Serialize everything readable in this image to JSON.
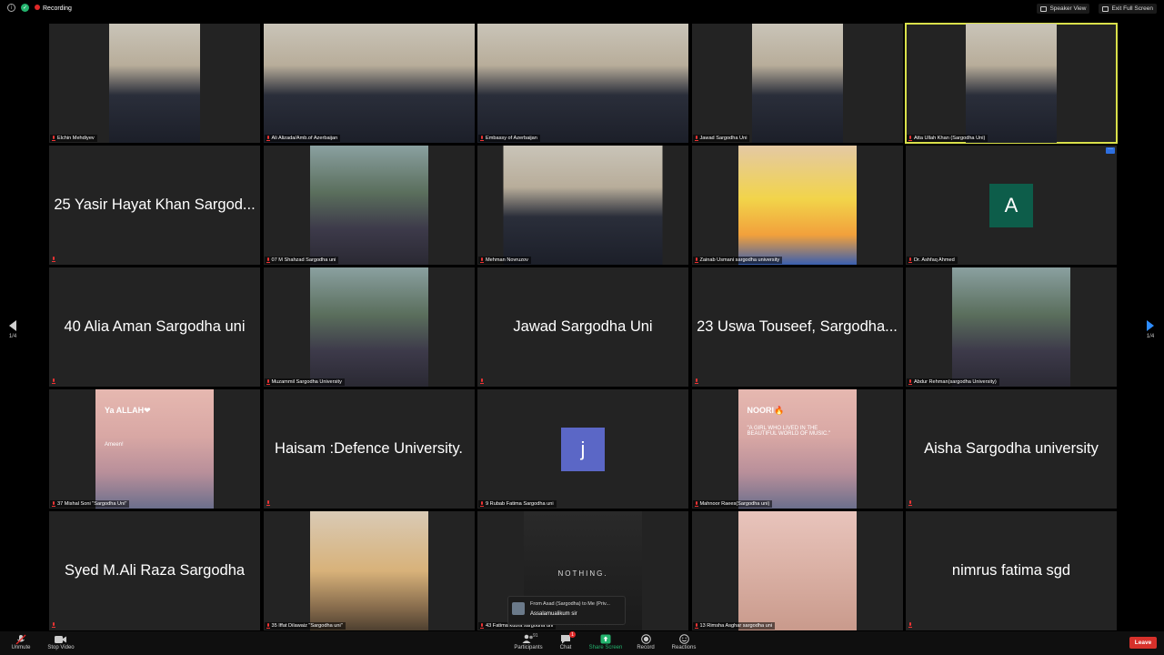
{
  "topbar": {
    "recording": "Recording",
    "speaker_view": "Speaker View",
    "exit_full_screen": "Exit Full Screen"
  },
  "pagination": {
    "left": "1/4",
    "right": "1/4"
  },
  "tiles": [
    {
      "name": "Elchin Mehdiyev",
      "kind": "video",
      "icon": "person-video"
    },
    {
      "name": "Ali Alizada/Amb.of Azerbaijan",
      "kind": "video",
      "icon": "person-video"
    },
    {
      "name": "Embassy of Azerbaijan",
      "kind": "video",
      "icon": "person-video"
    },
    {
      "name": "Jawad Sargodha Uni",
      "kind": "video",
      "icon": "person-video"
    },
    {
      "name": "Atta Ullah Khan (Sargodha Uni)",
      "kind": "video",
      "icon": "person-video",
      "active": true
    },
    {
      "name": "25 Yasir Hayat Khan Sargod...",
      "kind": "name"
    },
    {
      "name": "07 M Shahzad Sargodha uni",
      "kind": "video",
      "icon": "person-photo"
    },
    {
      "name": "Mehman Novruzov",
      "kind": "video",
      "icon": "person-video"
    },
    {
      "name": "Zainab Usmani sargodha university",
      "kind": "video",
      "icon": "cartoon-avatar"
    },
    {
      "name": "Dr. Ashfaq Ahmed",
      "kind": "avatar",
      "letter": "A",
      "color": "#0d5d4a"
    },
    {
      "name": "40 Alia Aman Sargodha uni",
      "kind": "name"
    },
    {
      "name": "Muzammil Sargodha University",
      "kind": "video",
      "icon": "person-photo"
    },
    {
      "name": "Jawad Sargodha Uni",
      "kind": "name"
    },
    {
      "name": "23 Uswa Touseef, Sargodha...",
      "kind": "name"
    },
    {
      "name": "Abdur Rehman(sargodha University)",
      "kind": "video",
      "icon": "person-photo"
    },
    {
      "name": "37 Mishal Soni \"Sargodha Uni\"",
      "kind": "video",
      "icon": "quote-image",
      "caption_title": "Ya ALLAH❤",
      "caption_text": "Ameen!"
    },
    {
      "name": "Haisam :Defence University.",
      "kind": "name"
    },
    {
      "name": "9 Rubab Fatima Sargodha uni",
      "kind": "avatar",
      "letter": "j",
      "color": "#5b67c6"
    },
    {
      "name": "Mahnoor Raees(Sargodha uni)",
      "kind": "video",
      "icon": "quote-image",
      "caption_title": "NOORI🔥",
      "caption_text": "\"A GIRL WHO LIVED IN THE BEAUTIFUL WORLD OF MUSIC.\""
    },
    {
      "name": "Aisha Sargodha university",
      "kind": "name"
    },
    {
      "name": "Syed M.Ali Raza Sargodha",
      "kind": "name"
    },
    {
      "name": "35 Iffat Dilawaiz \"Sargodha uni\"",
      "kind": "video",
      "icon": "smiley-image"
    },
    {
      "name": "43 Fatima kubra sargodha uni",
      "kind": "video",
      "icon": "rose-image",
      "caption_text": "NOTHING."
    },
    {
      "name": "13 Rimsha Asghar sargodha uni",
      "kind": "video",
      "icon": "baby-photo"
    },
    {
      "name": "nimrus fatima sgd",
      "kind": "name"
    }
  ],
  "chat_popup": {
    "from": "From Asad (Sargodha) to Me (Priv...",
    "message": "Assalamualikum sir"
  },
  "toolbar": {
    "unmute": "Unmute",
    "stop_video": "Stop Video",
    "participants": "Participants",
    "participants_count": "91",
    "chat": "Chat",
    "chat_badge": "1",
    "share_screen": "Share Screen",
    "record": "Record",
    "reactions": "Reactions",
    "leave": "Leave"
  },
  "colors": {
    "active_border": "#d9e04a",
    "share_green": "#23b26d",
    "leave_red": "#d7312b",
    "nav_blue": "#2d8cff"
  }
}
